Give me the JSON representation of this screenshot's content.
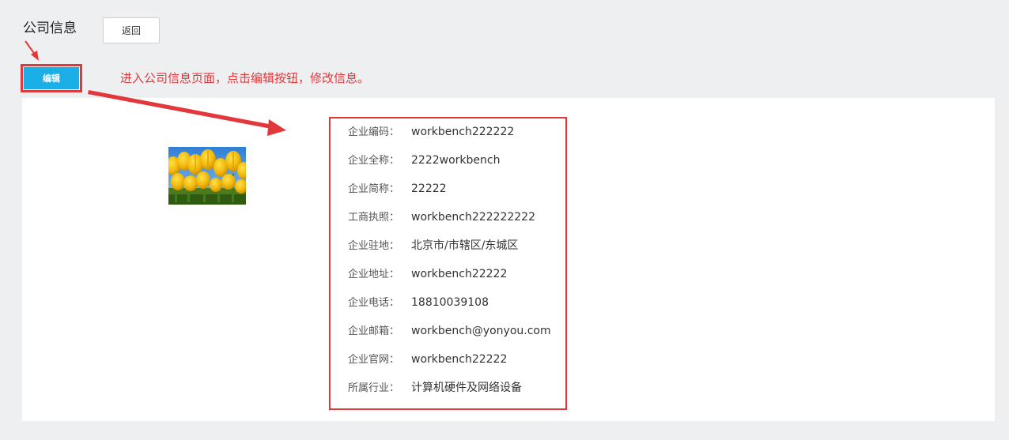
{
  "header": {
    "title": "公司信息",
    "back_label": "返回"
  },
  "toolbar": {
    "edit_label": "编辑"
  },
  "annotation": {
    "text": "进入公司信息页面，点击编辑按钮，修改信息。",
    "color": "#e2383b"
  },
  "company": {
    "logo": "tulip-photo",
    "fields": [
      {
        "label": "企业编码：",
        "value": "workbench222222"
      },
      {
        "label": "企业全称：",
        "value": "2222workbench"
      },
      {
        "label": "企业简称：",
        "value": "22222"
      },
      {
        "label": "工商执照：",
        "value": "workbench222222222"
      },
      {
        "label": "企业驻地：",
        "value": "北京市/市辖区/东城区"
      },
      {
        "label": "企业地址：",
        "value": "workbench22222"
      },
      {
        "label": "企业电话：",
        "value": "18810039108"
      },
      {
        "label": "企业邮箱：",
        "value": "workbench@yonyou.com"
      },
      {
        "label": "企业官网：",
        "value": "workbench22222"
      },
      {
        "label": "所属行业：",
        "value": "计算机硬件及网络设备"
      }
    ]
  },
  "colors": {
    "accent": "#1caee6",
    "highlight": "#e2383b",
    "background": "#eeeff1"
  }
}
